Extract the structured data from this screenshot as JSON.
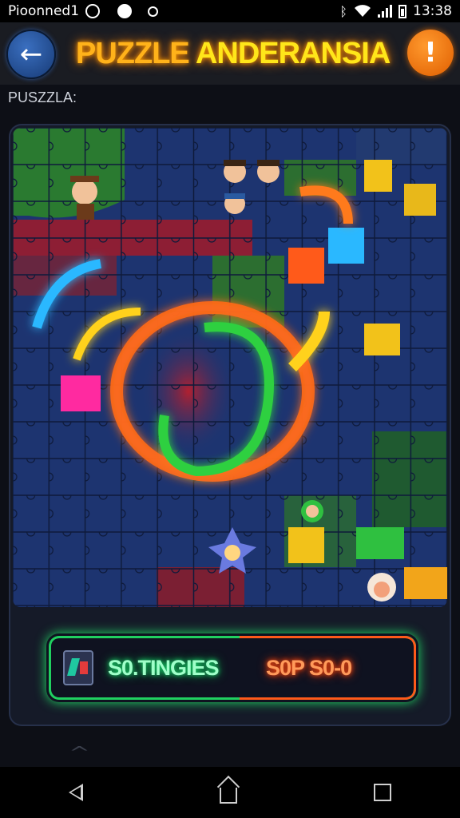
{
  "status_bar": {
    "carrier": "Pioonned1",
    "time": "13:38",
    "icons": [
      "clock-icon",
      "app-icon",
      "location-icon",
      "bluetooth-icon",
      "wifi-icon",
      "signal-icon",
      "battery-icon"
    ]
  },
  "header": {
    "title_part1": "PUZZLE",
    "title_part2": "ANDERANSIA",
    "back_icon": "←",
    "alert_icon": "!"
  },
  "section_label": "PUSZZLA:",
  "board": {
    "accent_colors": {
      "background": "#1d3470",
      "red": "#a11f2e",
      "green": "#1f7a2c",
      "yellow": "#f2c21a",
      "orange": "#ff6a1a",
      "pink": "#ff2aa0",
      "cyan": "#2ab8ff"
    },
    "characters": [
      "cowboy-character",
      "kid-character-1",
      "kid-character-2",
      "kid-character-3",
      "green-creature",
      "star-creature",
      "sheep-character"
    ]
  },
  "action_bar": {
    "left_label": "S0.TINGIES",
    "right_label": "S0P S0-0",
    "icon": "puzzle-box-icon",
    "left_color": "#22e066",
    "right_color": "#ff5a1a"
  },
  "nav_bar": {
    "items": [
      "back-nav-icon",
      "home-nav-icon",
      "recent-apps-icon"
    ]
  }
}
